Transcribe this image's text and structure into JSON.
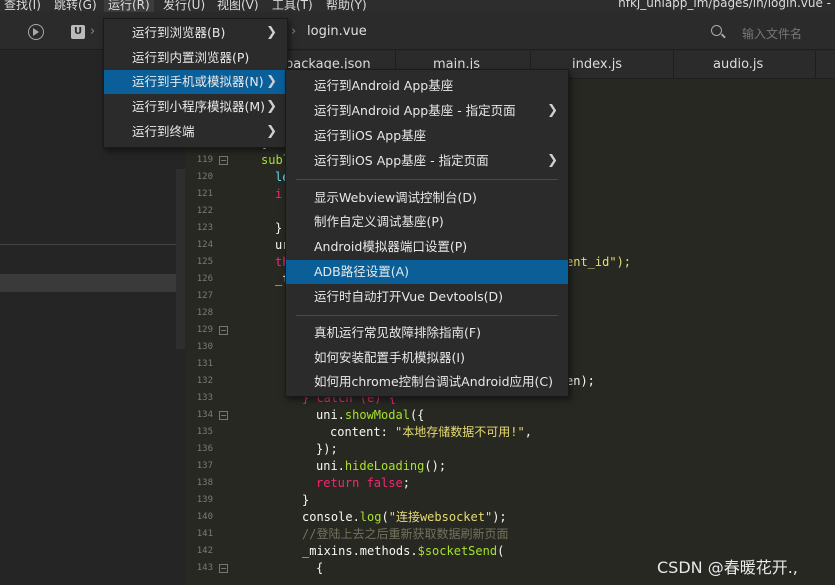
{
  "menubar": {
    "items": [
      "查找(I)",
      "跳转(G)",
      "运行(R)",
      "发行(U)",
      "视图(V)",
      "工具(T)",
      "帮助(Y)"
    ],
    "title_path": "nfkj_uniapp_im/pages/in/login.vue -"
  },
  "toolbar": {
    "breadcrumb": "login.vue",
    "search_placeholder": "输入文件名"
  },
  "tabs": [
    "package.json",
    "main.js",
    "index.js",
    "audio.js"
  ],
  "run_menu": {
    "items": [
      {
        "label": "运行到浏览器(B)",
        "submenu": true
      },
      {
        "label": "运行到内置浏览器(P)",
        "submenu": false
      },
      {
        "label": "运行到手机或模拟器(N)",
        "submenu": true,
        "active": true
      },
      {
        "label": "运行到小程序模拟器(M)",
        "submenu": true
      },
      {
        "label": "运行到终端",
        "submenu": true
      }
    ]
  },
  "device_menu": {
    "group1": [
      {
        "label": "运行到Android App基座",
        "submenu": false
      },
      {
        "label": "运行到Android App基座 - 指定页面",
        "submenu": true
      },
      {
        "label": "运行到iOS App基座",
        "submenu": false
      },
      {
        "label": "运行到iOS App基座 - 指定页面",
        "submenu": true
      }
    ],
    "group2": [
      {
        "label": "显示Webview调试控制台(D)"
      },
      {
        "label": "制作自定义调试基座(P)"
      },
      {
        "label": "Android模拟器端口设置(P)"
      },
      {
        "label": "ADB路径设置(A)",
        "active": true
      },
      {
        "label": "运行时自动打开Vue Devtools(D)"
      }
    ],
    "group3": [
      {
        "label": "真机运行常见故障排除指南(F)"
      },
      {
        "label": "如何安装配置手机模拟器(I)"
      },
      {
        "label": "如何用chrome控制台调试Android应用(C)"
      }
    ]
  },
  "editor": {
    "line_numbers": [
      "119",
      "120",
      "121",
      "122",
      "123",
      "124",
      "125",
      "126",
      "127",
      "128",
      "129",
      "130",
      "131",
      "132",
      "133",
      "134",
      "135",
      "136",
      "137",
      "138",
      "139",
      "140",
      "141",
      "142",
      "143"
    ],
    "fragments": {
      "l118": "}",
      "l119": "subl",
      "l120": "le",
      "l121": "i",
      "l123": "}",
      "l124": "ur",
      "l125a": "th",
      "l125b": "ent_id\");",
      "l126": "_t",
      "l132": "en);",
      "l133": "} catch (e) {",
      "l134a": "uni.",
      "l134b": "showModal",
      "l134c": "({",
      "l135a": "content: ",
      "l135b": "\"本地存储数据不可用!\"",
      "l135c": ",",
      "l136": "});",
      "l137a": "uni.",
      "l137b": "hideLoading",
      "l137c": "();",
      "l138a": "return ",
      "l138b": "false",
      "l138c": ";",
      "l139": "}",
      "l140a": "console.",
      "l140b": "log",
      "l140c": "(",
      "l140d": "\"连接websocket\"",
      "l140e": ");",
      "l141": "//登陆上去之后重新获取数据刷新页面",
      "l142a": "_mixins.methods.",
      "l142b": "$socketSend",
      "l142c": "(",
      "l143": "{"
    }
  },
  "watermark": "CSDN @春暖花开.,"
}
